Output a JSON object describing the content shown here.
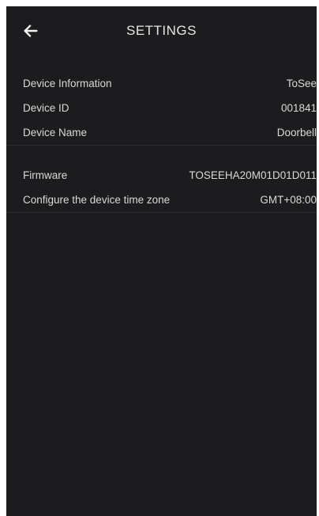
{
  "header": {
    "title": "SETTINGS",
    "back_icon": "arrow-left-icon"
  },
  "groups": [
    {
      "rows": [
        {
          "label": "Device Information",
          "value": "ToSee"
        },
        {
          "label": "Device ID",
          "value": "001841"
        },
        {
          "label": "Device Name",
          "value": "Doorbell"
        }
      ]
    },
    {
      "rows": [
        {
          "label": "Firmware",
          "value": "TOSEEHA20M01D01D011"
        },
        {
          "label": "Configure the device time zone",
          "value": "GMT+08:00"
        }
      ]
    }
  ],
  "colors": {
    "background": "#1c1c1e",
    "text": "#d9d9d9",
    "divider": "#2f2f32"
  }
}
